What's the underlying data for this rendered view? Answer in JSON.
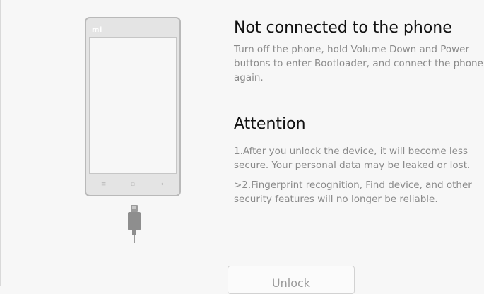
{
  "phone": {
    "brand_logo": "mi",
    "nav_keys": [
      "≡",
      "▫",
      "‹"
    ]
  },
  "connection": {
    "title": "Not connected to the phone",
    "instructions": "Turn off the phone, hold Volume Down and Power buttons to enter Bootloader, and connect the phone again."
  },
  "attention": {
    "title": "Attention",
    "item_1": "1.After you unlock the device, it will become less secure. Your personal data may be leaked or lost.",
    "item_2": ">2.Fingerprint recognition, Find device, and other security features will no longer be reliable."
  },
  "actions": {
    "unlock_label": "Unlock"
  },
  "colors": {
    "background": "#f7f7f7",
    "title": "#111111",
    "body_text": "#8a8a8a",
    "button_text": "#9a9a9a"
  }
}
